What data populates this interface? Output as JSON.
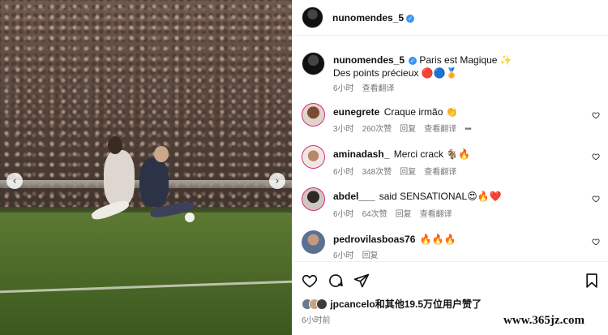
{
  "post": {
    "owner": "nunomendes_5",
    "caption_line1": "Paris est Magique ✨",
    "caption_line2": "Des points précieux 🔴🔵🏅",
    "caption_time": "6小时",
    "caption_translate": "查看翻译"
  },
  "comments": [
    {
      "user": "eunegrete",
      "text": "Craque irmão 👏",
      "time": "3小时",
      "likes": "260次赞",
      "reply": "回复",
      "translate": "查看翻译",
      "more": "•••"
    },
    {
      "user": "aminadash_",
      "text": "Merci crack 🐐🔥",
      "time": "6小时",
      "likes": "348次赞",
      "reply": "回复",
      "translate": "查看翻译"
    },
    {
      "user": "abdel___",
      "text": "said SENSATIONAL😍🔥❤️",
      "time": "6小时",
      "likes": "64次赞",
      "reply": "回复",
      "translate": "查看翻译"
    },
    {
      "user": "pedrovilasboas76",
      "text": "🔥🔥🔥",
      "time": "6小时",
      "reply": "回复"
    }
  ],
  "likes_summary": {
    "user": "jpcancelo",
    "rest": "和其他19.5万位用户赞了"
  },
  "post_time": "6小时前",
  "watermark": "www.365jz.com",
  "icons": {
    "verified": "verified-badge-icon",
    "like": "heart-icon",
    "comment": "comment-bubble-icon",
    "share": "paper-plane-icon",
    "save": "bookmark-icon",
    "prev": "chevron-left-icon",
    "next": "chevron-right-icon",
    "more": "more-options-icon"
  },
  "colors": {
    "verified": "#3897f0",
    "story_ring": "#d22f7c"
  }
}
